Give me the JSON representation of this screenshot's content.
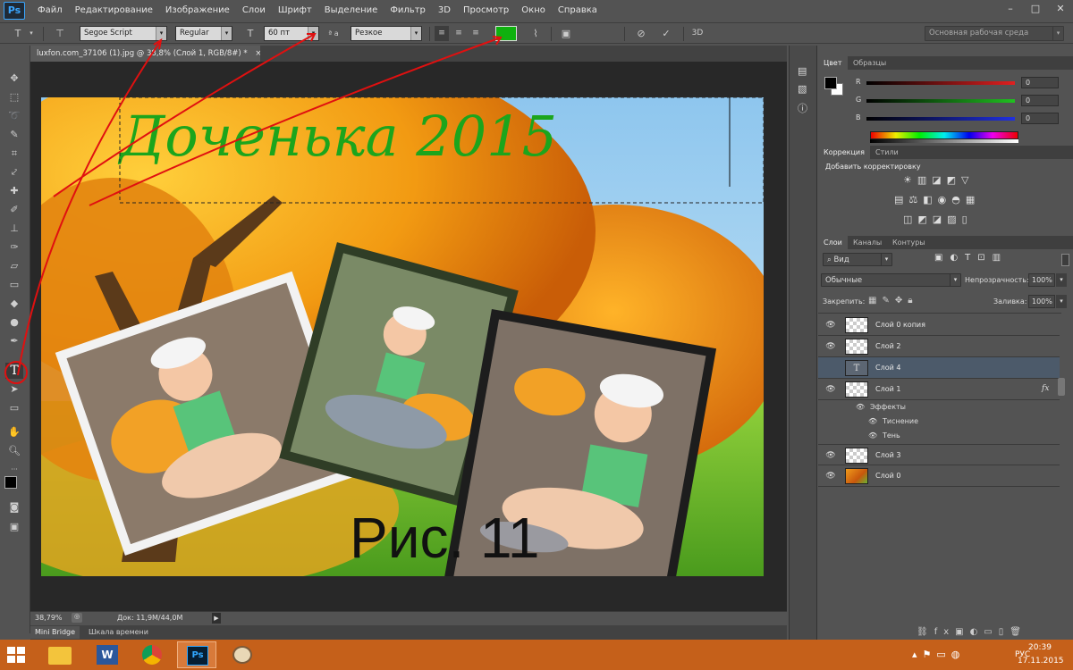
{
  "app": {
    "logo": "Ps",
    "menu": [
      "Файл",
      "Редактирование",
      "Изображение",
      "Слои",
      "Шрифт",
      "Выделение",
      "Фильтр",
      "3D",
      "Просмотр",
      "Окно",
      "Справка"
    ],
    "window_controls": [
      "–",
      "□",
      "✕"
    ]
  },
  "options": {
    "font_family": "Segoe Script",
    "font_style": "Regular",
    "font_size": "60 пт",
    "aa_label": "ª a",
    "antialias": "Резкое",
    "color": "#0fb10f",
    "threed": "3D",
    "workspace": "Основная рабочая среда"
  },
  "document": {
    "tab_title": "luxfon.com_37106 (1).jpg @ 38,8% (Слой 1, RGB/8#) *",
    "tab_close": "×",
    "title_text": "Доченька 2015",
    "caption": "Рис. 11"
  },
  "status": {
    "zoom": "38,79%",
    "doc": "Док: 11,9M/44,0M"
  },
  "bottom_tabs": [
    "Mini Bridge",
    "Шкала времени"
  ],
  "color_panel": {
    "tabs": [
      "Цвет",
      "Образцы"
    ],
    "channels": [
      {
        "label": "R",
        "value": "0",
        "color": "#e02020"
      },
      {
        "label": "G",
        "value": "0",
        "color": "#20c020"
      },
      {
        "label": "B",
        "value": "0",
        "color": "#2030e0"
      }
    ]
  },
  "adjust_panel": {
    "tabs": [
      "Коррекция",
      "Стили"
    ],
    "heading": "Добавить корректировку"
  },
  "layers_panel": {
    "tabs": [
      "Слои",
      "Каналы",
      "Контуры"
    ],
    "filter": "Вид",
    "blend_mode": "Обычные",
    "opacity_label": "Непрозрачность:",
    "opacity": "100%",
    "lock_label": "Закрепить:",
    "fill_label": "Заливка:",
    "fill": "100%",
    "layers": [
      {
        "name": "Слой 0 копия",
        "thumb": "checker"
      },
      {
        "name": "Слой 2",
        "thumb": "checker"
      },
      {
        "name": "Слой 4",
        "thumb": "text",
        "selected": true
      },
      {
        "name": "Слой 1",
        "thumb": "checker",
        "fx": "fx"
      }
    ],
    "effects_label": "Эффекты",
    "effects": [
      "Тиснение",
      "Тень"
    ],
    "layers_after": [
      {
        "name": "Слой 3",
        "thumb": "checker"
      },
      {
        "name": "Слой 0",
        "thumb": "autumn"
      }
    ]
  },
  "taskbar": {
    "lang": "РУС",
    "time": "20:39",
    "date": "17.11.2015"
  }
}
